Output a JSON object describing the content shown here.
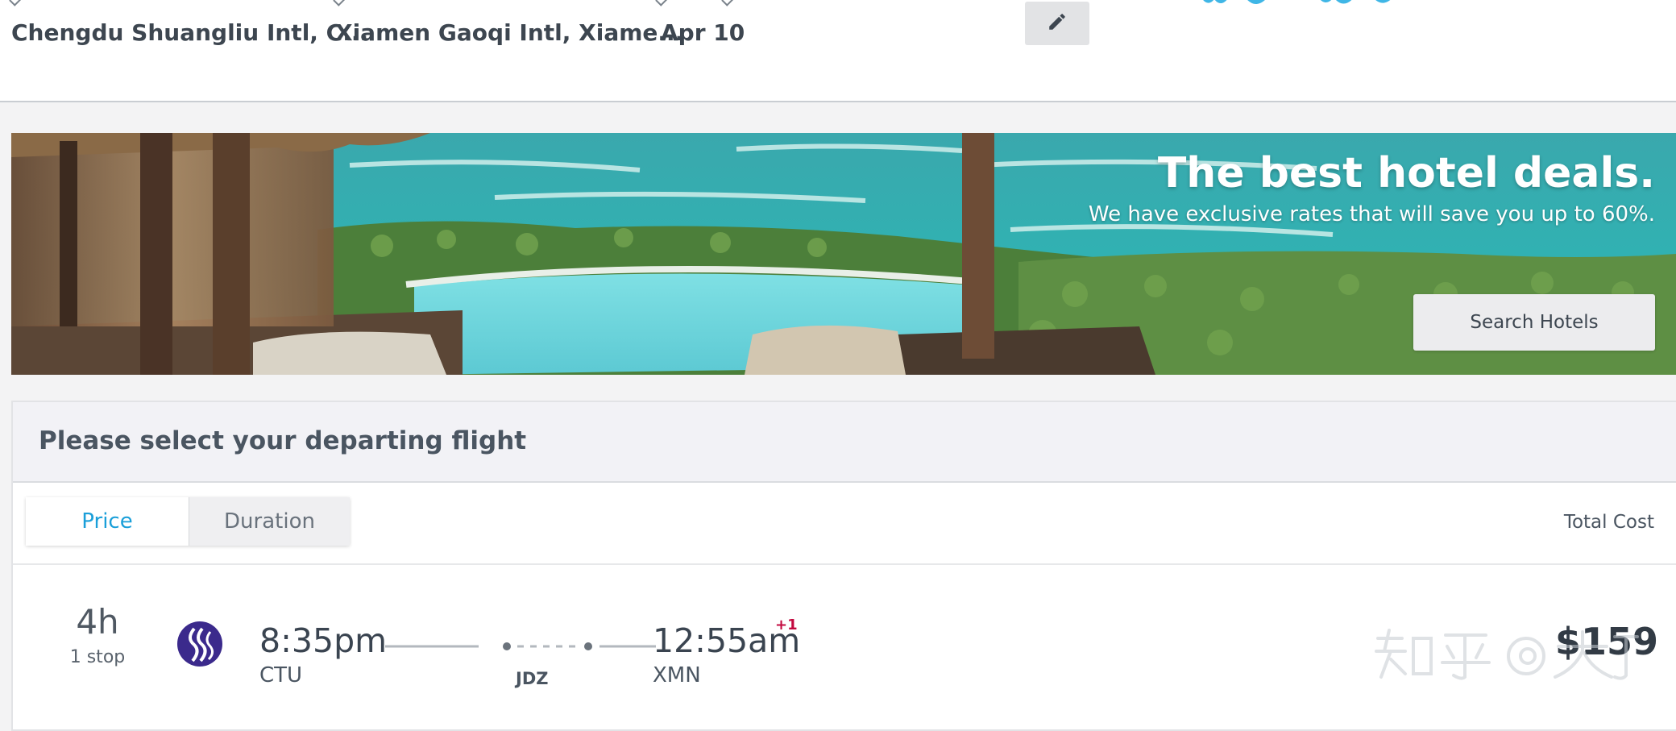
{
  "search": {
    "origin": "Chengdu Shuangliu Intl, C...",
    "destination": "Xiamen Gaoqi Intl, Xiame...",
    "date": "Apr 10",
    "edit_icon": "pencil-icon"
  },
  "banner": {
    "title": "The best hotel deals.",
    "subtitle": "We have exclusive rates that will save you up to 60%.",
    "button_label": "Search Hotels"
  },
  "results": {
    "heading": "Please select your departing flight",
    "sort_tabs": [
      {
        "label": "Price",
        "active": true
      },
      {
        "label": "Duration",
        "active": false
      }
    ],
    "total_cost_label": "Total Cost"
  },
  "flights": [
    {
      "duration": "4h",
      "stops": "1 stop",
      "airline_icon": "airline-logo-icon",
      "depart_time": "8:35pm",
      "depart_code": "CTU",
      "stop_code": "JDZ",
      "arrive_time": "12:55am",
      "day_offset": "+1",
      "arrive_code": "XMN",
      "price": "$159"
    }
  ],
  "watermark": "知乎 @大丁",
  "colors": {
    "accent": "#1a9fd9",
    "day_offset": "#c3093f",
    "airline": "#3b2a8c"
  }
}
